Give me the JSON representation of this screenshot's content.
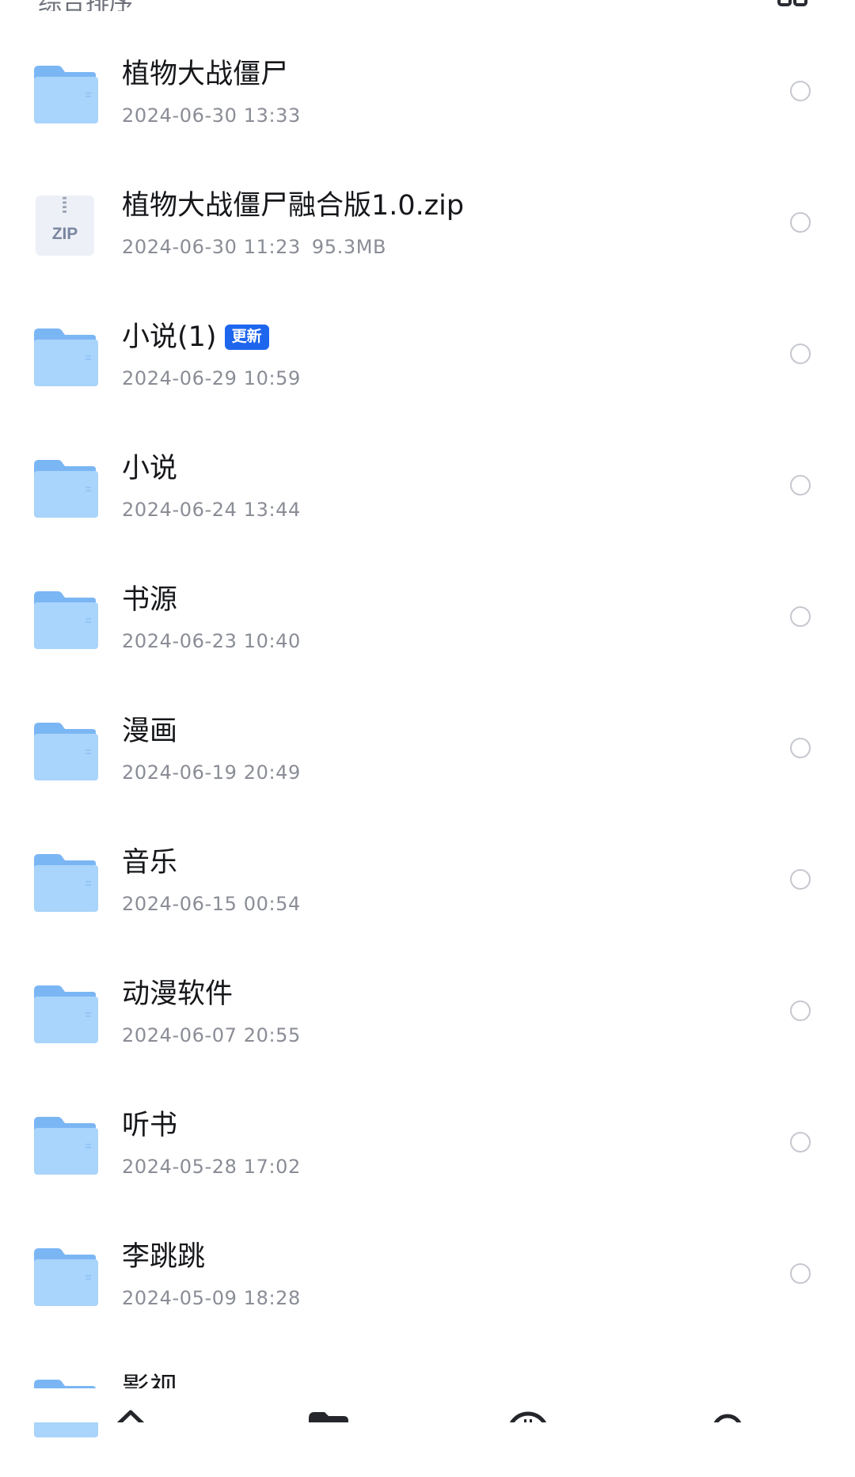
{
  "header": {
    "sort_label": "综合排序",
    "view_toggle_icon": "grid-view-icon"
  },
  "files": [
    {
      "name": "植物大战僵尸",
      "meta": "2024-06-30 13:33",
      "icon": "folder-icon"
    },
    {
      "name": "植物大战僵尸融合版1.0.zip",
      "meta": "2024-06-30 11:23",
      "size": "95.3MB",
      "icon": "zip-file-icon",
      "thumb_label": "ZIP"
    },
    {
      "name": "小说(1)",
      "meta": "2024-06-29 10:59",
      "icon": "folder-icon",
      "badge": "更新"
    },
    {
      "name": "小说",
      "meta": "2024-06-24 13:44",
      "icon": "folder-icon"
    },
    {
      "name": "书源",
      "meta": "2024-06-23 10:40",
      "icon": "folder-icon"
    },
    {
      "name": "漫画",
      "meta": "2024-06-19 20:49",
      "icon": "folder-icon"
    },
    {
      "name": "音乐",
      "meta": "2024-06-15 00:54",
      "icon": "folder-icon"
    },
    {
      "name": "动漫软件",
      "meta": "2024-06-07 20:55",
      "icon": "folder-icon"
    },
    {
      "name": "听书",
      "meta": "2024-05-28 17:02",
      "icon": "folder-icon"
    },
    {
      "name": "李跳跳",
      "meta": "2024-05-09 18:28",
      "icon": "folder-icon"
    },
    {
      "name": "影视",
      "meta": "",
      "icon": "folder-icon"
    }
  ],
  "bottom_nav": {
    "items": [
      {
        "icon": "home-icon"
      },
      {
        "icon": "files-folder-icon"
      },
      {
        "icon": "share-clock-icon"
      },
      {
        "icon": "profile-icon"
      }
    ]
  },
  "colors": {
    "accent": "#1f66ee",
    "folder_light": "#a9d4fb",
    "folder_dark": "#7bb6f4",
    "meta_text": "#8a8d96"
  }
}
